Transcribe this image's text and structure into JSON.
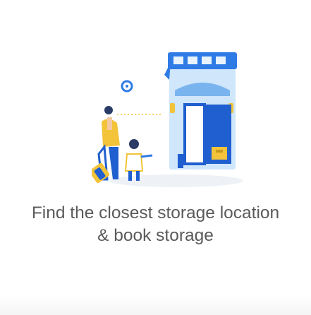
{
  "onboarding": {
    "headline_line1": "Find the closest storage location",
    "headline_line2": "& book storage"
  },
  "icons": {
    "illustration": "traveler-at-storage-shop-illustration",
    "pin": "location-pin-icon",
    "luggage": "suitcase-icon"
  },
  "colors": {
    "primary_blue": "#1f6fe0",
    "light_blue": "#9ec8f2",
    "accent_yellow": "#f3c33a",
    "text_gray": "#5a5a5a"
  }
}
